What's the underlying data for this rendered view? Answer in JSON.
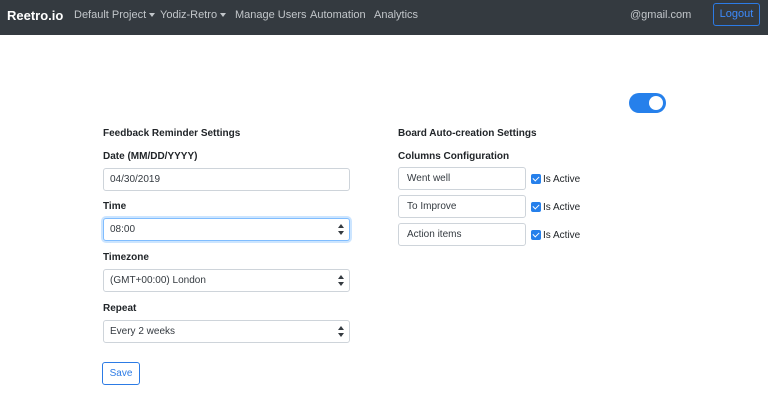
{
  "navbar": {
    "brand": "Reetro.io",
    "items": [
      {
        "label": "Default Project",
        "dropdown": true
      },
      {
        "label": "Yodiz-Retro",
        "dropdown": true
      },
      {
        "label": "Manage Users",
        "dropdown": false
      },
      {
        "label": "Automation",
        "dropdown": false
      },
      {
        "label": "Analytics",
        "dropdown": false
      }
    ],
    "email": "@gmail.com",
    "logout_label": "Logout"
  },
  "toggle": {
    "on": true,
    "color": "#2680eb"
  },
  "feedback": {
    "title": "Feedback Reminder Settings",
    "date_label": "Date (MM/DD/YYYY)",
    "date_value": "04/30/2019",
    "time_label": "Time",
    "time_value": "08:00",
    "timezone_label": "Timezone",
    "timezone_value": "(GMT+00:00) London",
    "repeat_label": "Repeat",
    "repeat_value": "Every 2 weeks",
    "save_label": "Save"
  },
  "board": {
    "title": "Board Auto-creation Settings",
    "columns_label": "Columns Configuration",
    "columns": [
      {
        "name": "Went well",
        "active_label": "Is Active",
        "active": true
      },
      {
        "name": "To Improve",
        "active_label": "Is Active",
        "active": true
      },
      {
        "name": "Action items",
        "active_label": "Is Active",
        "active": true
      }
    ]
  },
  "colors": {
    "navbar": "#343a40",
    "accent": "#2680eb"
  }
}
